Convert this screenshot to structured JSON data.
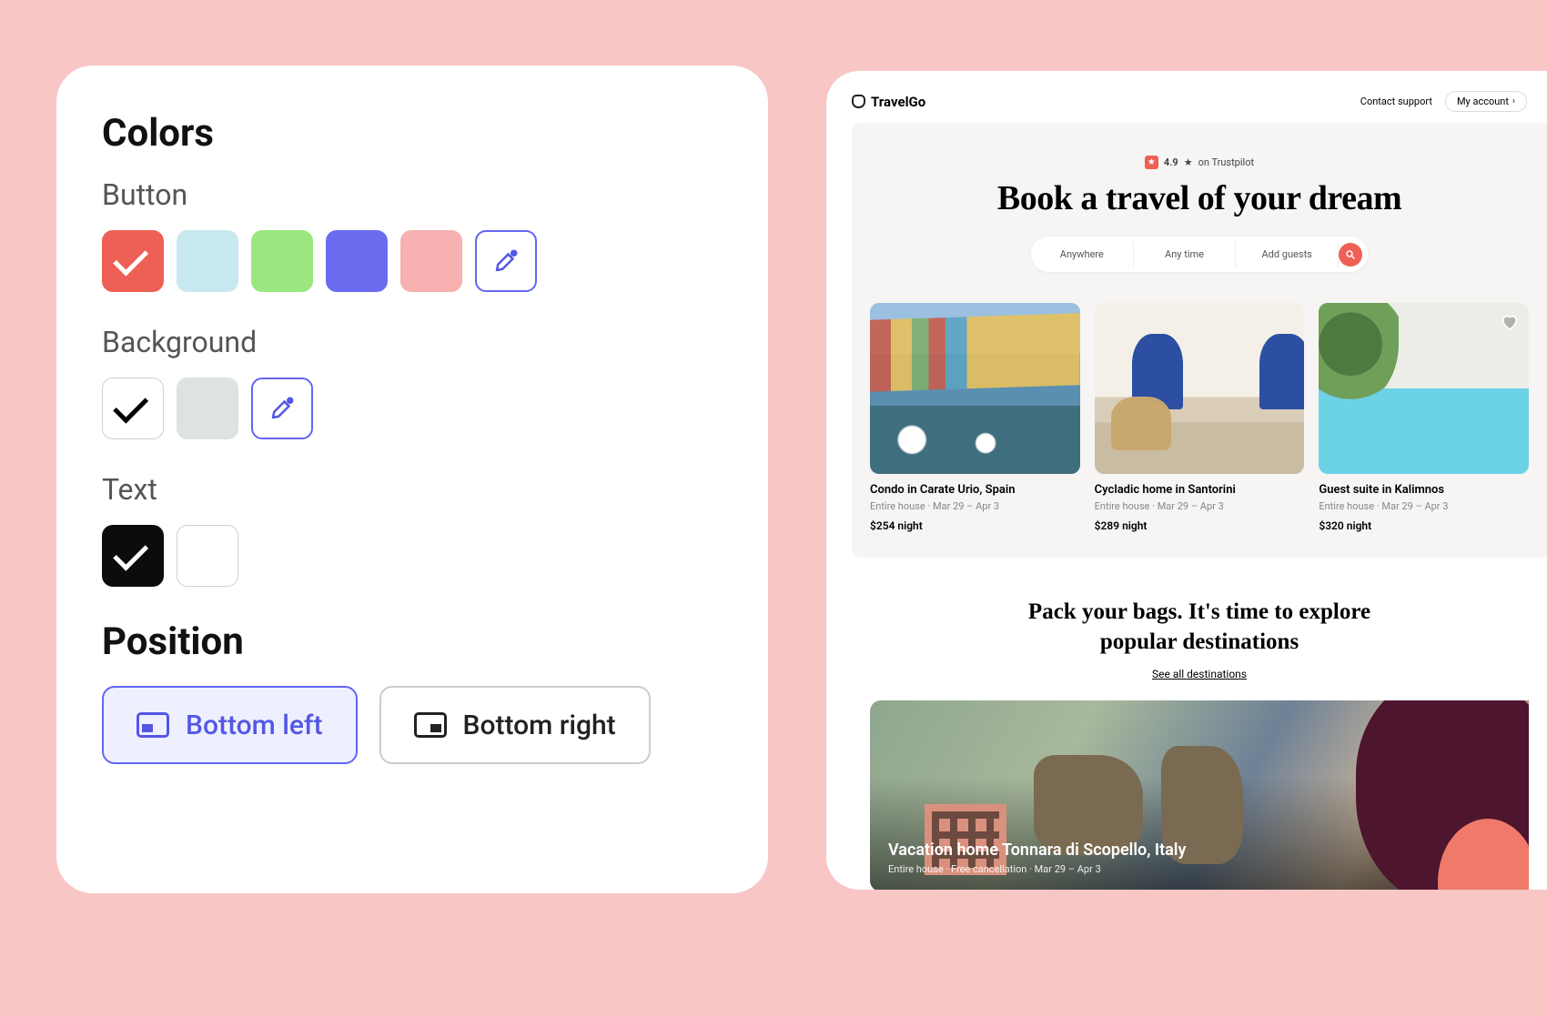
{
  "settings": {
    "colors_title": "Colors",
    "button_label": "Button",
    "button_swatches": [
      "#EE6055",
      "#C7E9EF",
      "#9BE77F",
      "#6A6CF0",
      "#F7B1B1"
    ],
    "button_selected_index": 0,
    "background_label": "Background",
    "background_swatches": [
      "#FFFFFF",
      "#DDE3DF"
    ],
    "background_selected_index": 0,
    "text_label": "Text",
    "text_swatches": [
      "#0C0C0C",
      "#FFFFFF"
    ],
    "text_selected_index": 0,
    "position_title": "Position",
    "position_options": {
      "left": "Bottom left",
      "right": "Bottom right"
    },
    "position_selected": "left"
  },
  "preview": {
    "brand": "TravelGo",
    "top_links": {
      "support": "Contact support",
      "account": "My account"
    },
    "rating": {
      "score": "4.9",
      "star": "★",
      "label": "on Trustpilot"
    },
    "hero_title": "Book a travel of your dream",
    "search": {
      "where": "Anywhere",
      "when": "Any time",
      "who": "Add guests"
    },
    "listings": [
      {
        "title": "Condo in Carate Urio, Spain",
        "subtitle": "Entire house  ·  Mar 29 – Apr 3",
        "price": "$254 night"
      },
      {
        "title": "Cycladic home in Santorini",
        "subtitle": "Entire house  ·  Mar 29 – Apr 3",
        "price": "$289 night"
      },
      {
        "title": "Guest suite in Kalimnos",
        "subtitle": "Entire house  ·  Mar 29 – Apr 3",
        "price": "$320 night"
      }
    ],
    "pack_title_line1": "Pack your bags. It's time to explore",
    "pack_title_line2": "popular destinations",
    "pack_link": "See all destinations",
    "destination": {
      "title": "Vacation home Tonnara di Scopello, Italy",
      "subtitle": "Entire house   ·   Free cancellation   ·   Mar 29 – Apr 3"
    }
  }
}
